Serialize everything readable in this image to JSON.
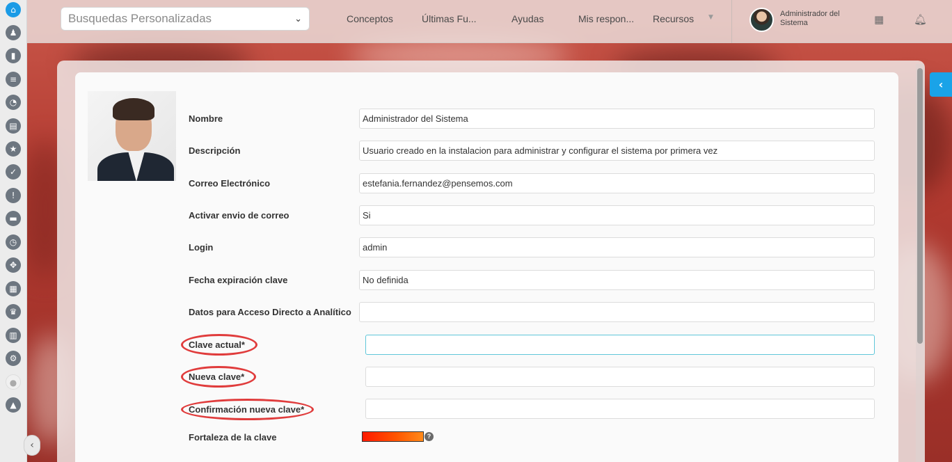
{
  "header": {
    "search_select": "Busquedas Personalizadas",
    "nav": [
      "Conceptos",
      "Últimas Fu...",
      "Ayudas",
      "Mis respon...",
      "Recursos"
    ],
    "user_name": "Administrador del Sistema"
  },
  "sidebar": {
    "icons": [
      "home-icon",
      "chess-piece-icon",
      "bar-chart-icon",
      "list-icon",
      "pie-chart-icon",
      "document-icon",
      "award-icon",
      "check-icon",
      "alert-icon",
      "monitor-icon",
      "clock-icon",
      "move-icon",
      "grid-icon",
      "crown-icon",
      "book-icon",
      "gear-icon",
      "lightbulb-icon",
      "warning-icon"
    ]
  },
  "form": {
    "fields": [
      {
        "label": "Nombre",
        "value": "Administrador del Sistema"
      },
      {
        "label": "Descripción",
        "value": "Usuario creado en la instalacion para administrar y configurar el sistema por primera vez"
      },
      {
        "label": "Correo Electrónico",
        "value": "estefania.fernandez@pensemos.com"
      },
      {
        "label": "Activar envio de correo",
        "value": "Si"
      },
      {
        "label": "Login",
        "value": "admin"
      },
      {
        "label": "Fecha expiración clave",
        "value": "No definida"
      },
      {
        "label": "Datos para Acceso Directo a Analítico",
        "value": ""
      }
    ],
    "password_fields": [
      {
        "label": "Clave actual*",
        "value": ""
      },
      {
        "label": "Nueva clave*",
        "value": ""
      },
      {
        "label": "Confirmación nueva clave*",
        "value": ""
      }
    ],
    "strength_label": "Fortaleza de la clave",
    "strength_help": "?"
  },
  "colors": {
    "accent": "#1aa3e8",
    "highlight": "#e03c3c"
  }
}
